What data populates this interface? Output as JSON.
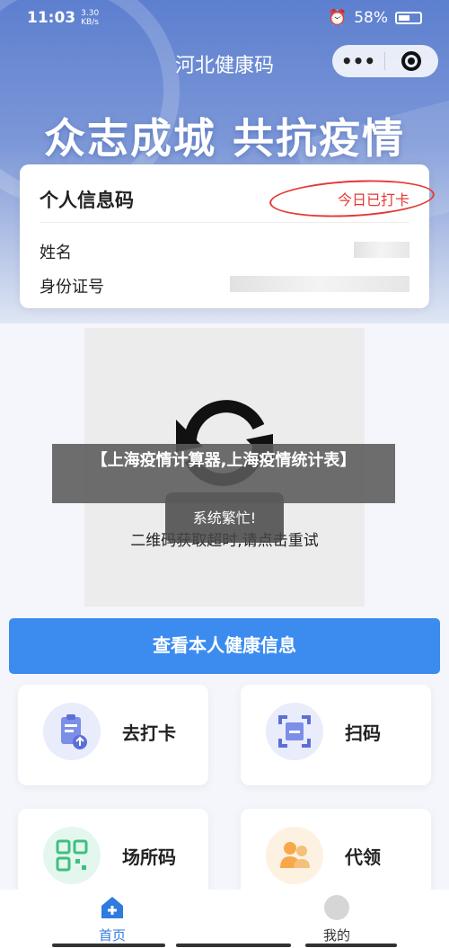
{
  "status_bar": {
    "time": "11:03",
    "network_speed": "3.30 KB/s",
    "battery": "58%"
  },
  "nav": {
    "title": "河北健康码",
    "more_label": "•••"
  },
  "slogan": "众志成城 共抗疫情",
  "info_card": {
    "title": "个人信息码",
    "checkin_link": "今日已打卡",
    "name_label": "姓名",
    "id_label": "身份证号"
  },
  "qr_panel": {
    "message": "二维码获取超时,请点击重试"
  },
  "toast": "系统繁忙!",
  "overlay_banner": "【上海疫情计算器,上海疫情统计表】",
  "primary_button": "查看本人健康信息",
  "tiles": [
    {
      "label": "去打卡",
      "icon": "clipboard-upload-icon"
    },
    {
      "label": "扫码",
      "icon": "scan-frame-icon"
    },
    {
      "label": "场所码",
      "icon": "qr-code-icon"
    },
    {
      "label": "代领",
      "icon": "people-icon"
    }
  ],
  "tabbar": {
    "home": "首页",
    "mine": "我的"
  },
  "colors": {
    "primary": "#3c8cf0",
    "checkin_red": "#e53935",
    "toast_bg": "#464646"
  }
}
